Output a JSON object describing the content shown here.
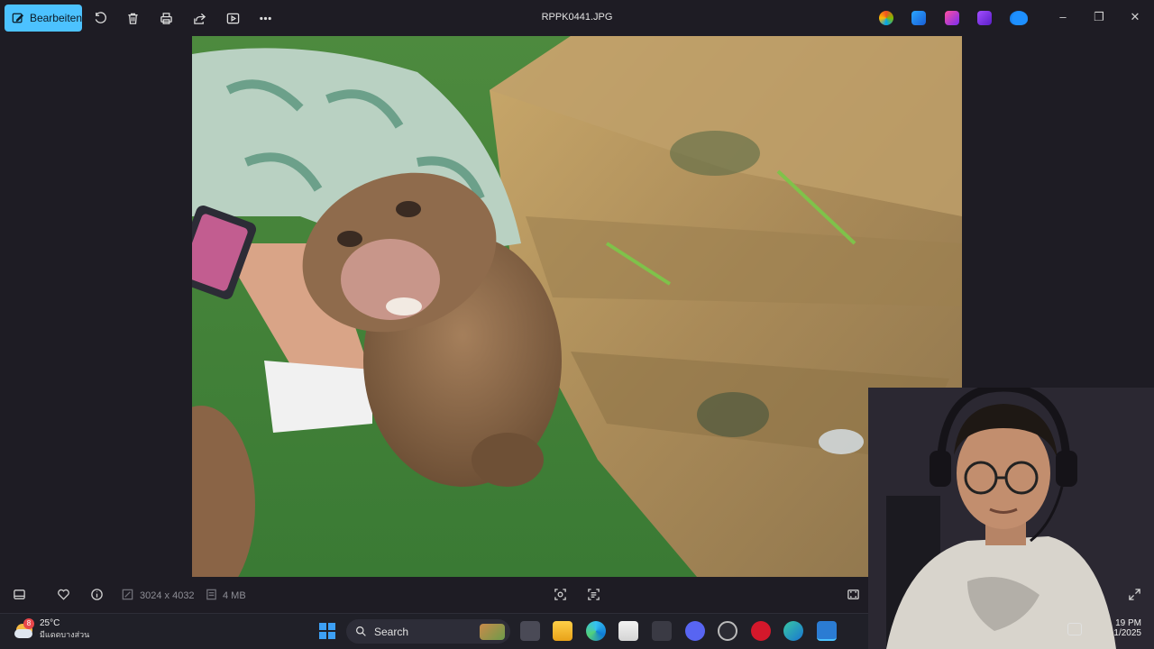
{
  "window": {
    "title": "RPPK0441.JPG",
    "edit_label": "Bearbeiten"
  },
  "toolbar_icons": [
    "rotate-icon",
    "delete-icon",
    "print-icon",
    "share-icon",
    "slideshow-icon",
    "more-icon"
  ],
  "info": {
    "dimensions": "3024 x 4032",
    "size": "4 MB"
  },
  "taskbar": {
    "weather_badge": "8",
    "weather_temp": "25°C",
    "weather_desc": "มีแดดบางส่วน",
    "search_label": "Search",
    "time": "19 PM",
    "date": "1/2025"
  },
  "colors": {
    "accent": "#4cc2ff",
    "background": "#1e1c24"
  }
}
